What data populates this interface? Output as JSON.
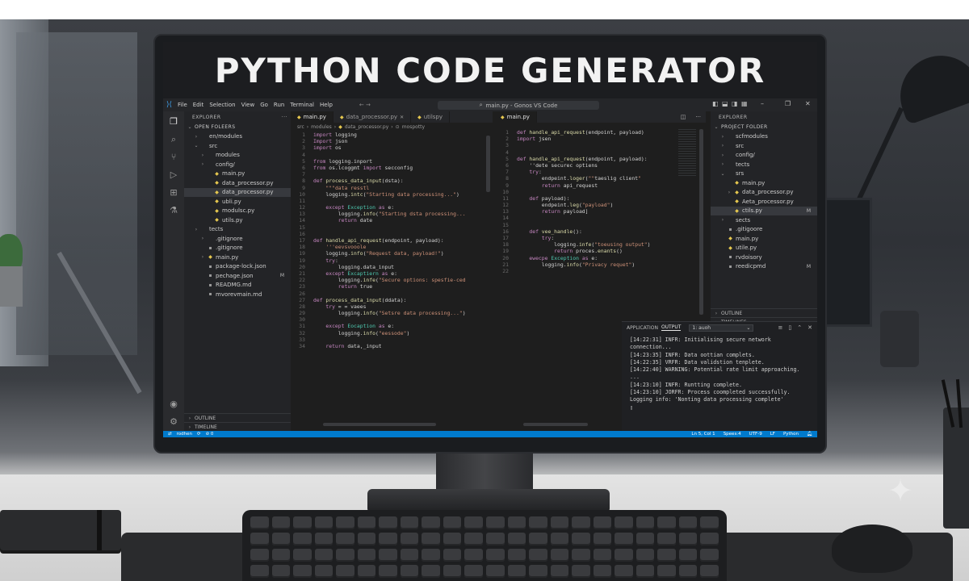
{
  "headline": "PYTHON CODE GENERATOR",
  "titlebar": {
    "menu": [
      "File",
      "Edit",
      "Selection",
      "View",
      "Go",
      "Run",
      "Terminal",
      "Help"
    ],
    "command_center": "main.py - Gonos VS Code",
    "nav": "← →"
  },
  "left_sidebar": {
    "header": "EXPLORER",
    "section": "OPEN FOLEERS",
    "items": [
      {
        "label": "en/modules",
        "indent": 1,
        "chevron": "›"
      },
      {
        "label": "src",
        "indent": 1,
        "chevron": "⌄"
      },
      {
        "label": "modules",
        "indent": 2,
        "chevron": "›"
      },
      {
        "label": "config/",
        "indent": 2,
        "chevron": "›"
      },
      {
        "label": "main.py",
        "indent": 3,
        "chevron": ""
      },
      {
        "label": "data_processor.py",
        "indent": 3,
        "chevron": ""
      },
      {
        "label": "data_processor.py",
        "indent": 3,
        "chevron": "",
        "selected": true
      },
      {
        "label": "ubli.py",
        "indent": 3,
        "chevron": ""
      },
      {
        "label": "modulsc.py",
        "indent": 3,
        "chevron": ""
      },
      {
        "label": "utils.py",
        "indent": 3,
        "chevron": ""
      },
      {
        "label": "tects",
        "indent": 1,
        "chevron": "›"
      },
      {
        "label": ".gitignore",
        "indent": 2,
        "chevron": "›"
      },
      {
        "label": ".gitignore",
        "indent": 2,
        "chevron": ""
      },
      {
        "label": "main.py",
        "indent": 2,
        "chevron": "›"
      },
      {
        "label": "package-lock.json",
        "indent": 2,
        "chevron": ""
      },
      {
        "label": "pechage.json",
        "indent": 2,
        "chevron": "",
        "badge": "M"
      },
      {
        "label": "READMG.md",
        "indent": 2,
        "chevron": ""
      },
      {
        "label": "mvorevmain.md",
        "indent": 2,
        "chevron": ""
      }
    ],
    "outline": "OUTLINE",
    "timeline": "TIMELINE"
  },
  "editor_left": {
    "tabs": [
      "main.py",
      "data_processor.py",
      "utilspy"
    ],
    "breadcrumb": [
      "src",
      "modules",
      "data_processor.py",
      "mospotty"
    ],
    "lines": [
      [
        "1",
        "import logging"
      ],
      [
        "2",
        "Import json"
      ],
      [
        "3",
        "import os"
      ],
      [
        "4",
        ""
      ],
      [
        "5",
        "from logging.inport"
      ],
      [
        "6",
        "from os.lcoggmt import secconfig"
      ],
      [
        "7",
        ""
      ],
      [
        "8",
        "def process_data_input(dsta):"
      ],
      [
        "9",
        "    \"\"\"data resstl"
      ],
      [
        "10",
        "    logging.intc(\"Starting data processing...\")"
      ],
      [
        "11",
        ""
      ],
      [
        "12",
        "    except Exception as e:"
      ],
      [
        "13",
        "        logging.info(\"Starting dsta processing..."
      ],
      [
        "14",
        "        return date"
      ],
      [
        "15",
        ""
      ],
      [
        "16",
        ""
      ],
      [
        "17",
        "def handle_api_request(endpoint, payload):"
      ],
      [
        "18",
        "    '''eevsvooole"
      ],
      [
        "19",
        "    logging.info(\"Request data, payload!\")"
      ],
      [
        "19",
        "    try:"
      ],
      [
        "20",
        "        logging.data_input"
      ],
      [
        "21",
        "    except Excaptiern as e:"
      ],
      [
        "22",
        "        logging.infe(\"Secure options: spesfie-ced"
      ],
      [
        "23",
        "        return true"
      ],
      [
        "26",
        ""
      ],
      [
        "27",
        "def process_data_input(ddata):"
      ],
      [
        "28",
        "    try = = vaees"
      ],
      [
        "29",
        "        logging.info(\"Setsre data processing...\")"
      ],
      [
        "30",
        ""
      ],
      [
        "31",
        "    except Eocaption as e:"
      ],
      [
        "32",
        "        logging.info(\"eessode\")"
      ],
      [
        "33",
        ""
      ],
      [
        "34",
        "    return data,_input"
      ]
    ]
  },
  "editor_right": {
    "tabs": [
      "main.py"
    ],
    "lines": [
      [
        "1",
        "def handle_api_request(endpoint, payload)"
      ],
      [
        "2",
        "import jsen"
      ],
      [
        "3",
        ""
      ],
      [
        "4",
        ""
      ],
      [
        "5",
        "def handle_api_request(endpoint, payload):"
      ],
      [
        "6",
        "    ''dete securec optiens"
      ],
      [
        "7",
        "    try:"
      ],
      [
        "8",
        "        endpeint.loger(\"\"taeslig client\""
      ],
      [
        "9",
        "        return api_request"
      ],
      [
        "10",
        ""
      ],
      [
        "11",
        "    def payload):"
      ],
      [
        "12",
        "        endpeint.leg(\"payload\")"
      ],
      [
        "13",
        "        return payload]"
      ],
      [
        "14",
        ""
      ],
      [
        "15",
        ""
      ],
      [
        "16",
        "    def vee_handle():"
      ],
      [
        "17",
        "        try:"
      ],
      [
        "18",
        "            logging.infe(\"toeusing output\")"
      ],
      [
        "19",
        "            return proces.enants()"
      ],
      [
        "20",
        "    ewecpe Exception as e:"
      ],
      [
        "21",
        "        logging.info(\"Privacy requet\")"
      ],
      [
        "22",
        ""
      ]
    ]
  },
  "right_sidebar": {
    "header": "EXPLORER",
    "section": "PROJECT FOLDER",
    "items": [
      {
        "label": "scfmodules",
        "indent": 1,
        "chevron": "›"
      },
      {
        "label": "src",
        "indent": 1,
        "chevron": "›"
      },
      {
        "label": "config/",
        "indent": 1,
        "chevron": "›"
      },
      {
        "label": "tects",
        "indent": 1,
        "chevron": "›"
      },
      {
        "label": "srs",
        "indent": 1,
        "chevron": "⌄"
      },
      {
        "label": "main.py",
        "indent": 2,
        "chevron": ""
      },
      {
        "label": "data_processor.py",
        "indent": 2,
        "chevron": "›"
      },
      {
        "label": "Aeta_processor.py",
        "indent": 2,
        "chevron": ""
      },
      {
        "label": "ctils.py",
        "indent": 2,
        "chevron": "",
        "selected": true,
        "badge": "M"
      },
      {
        "label": "sects",
        "indent": 1,
        "chevron": "›"
      },
      {
        "label": ".gitigoore",
        "indent": 1,
        "chevron": ""
      },
      {
        "label": "main.py",
        "indent": 1,
        "chevron": ""
      },
      {
        "label": "utile.py",
        "indent": 1,
        "chevron": ""
      },
      {
        "label": "rvdoisory",
        "indent": 1,
        "chevron": ""
      },
      {
        "label": "reedicpmd",
        "indent": 1,
        "chevron": "",
        "badge": "M"
      }
    ],
    "outline": "OUTLINE",
    "timelines": "TIMELINES"
  },
  "panel": {
    "tab_prefix": "APPLICATION",
    "tab_active": "OUTPUT",
    "select_value": "1: auoh",
    "log": [
      "[14:22:31] INFR: Initialising secure network",
      "connection...",
      "[14:23:35] INFR: Data oottian complets.",
      "[14:22:35] VRFR: Data validstion tenplete.",
      "[14:22:40] WARNING: Potential rate limit approaching.",
      "...",
      "[14:23:10] INFR: Runtting complete.",
      "[14:23:10] JORFR: Process coompleted successfully.",
      "Logging info: 'Nonting data processing complete'",
      "▯"
    ]
  },
  "statusbar": {
    "branch": "rodhen",
    "sync": "⟳",
    "problems": "⊘ 0",
    "position": "Ln 5, Col 1",
    "spaces": "Spees:4",
    "encoding": "UTF-9",
    "eol": "LF",
    "language": "Python"
  },
  "colors": {
    "keyword": "#c586c0",
    "function": "#dcdcaa",
    "string": "#ce9178",
    "module": "#4ec9b0",
    "accent_blue": "#007acc",
    "py_icon": "#e6c84f"
  }
}
